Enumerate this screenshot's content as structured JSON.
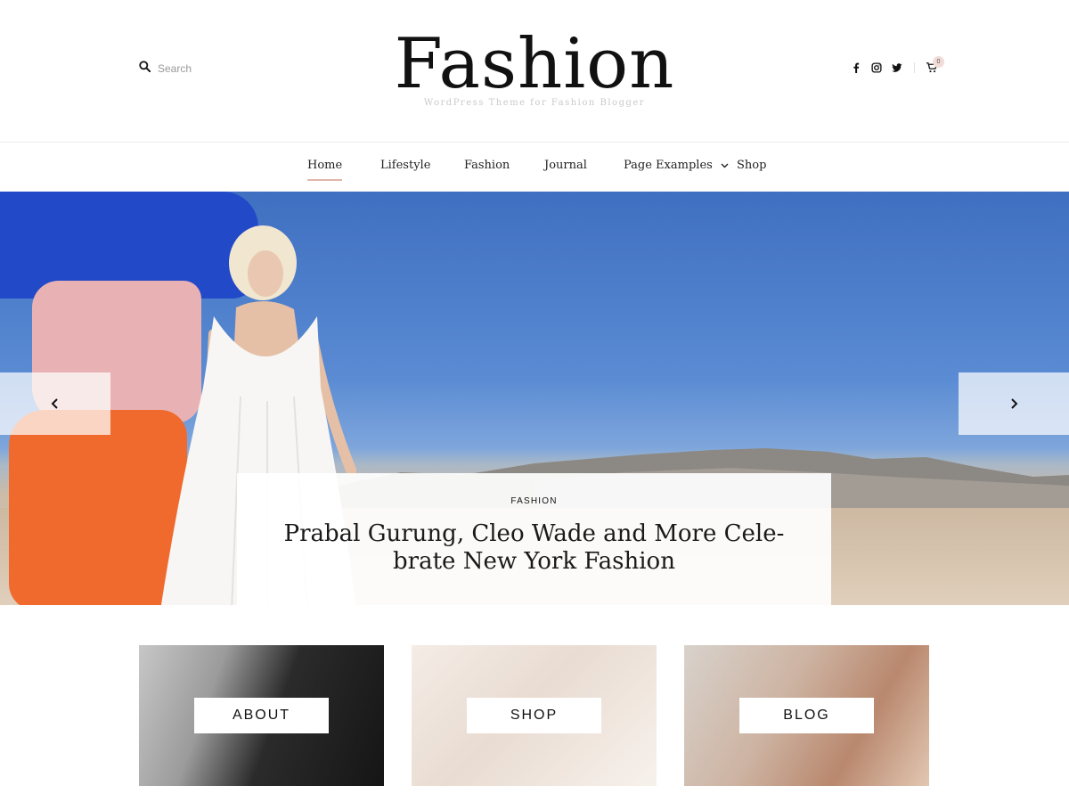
{
  "header": {
    "search_placeholder": "Search",
    "logo": "Fashion",
    "tagline": "WordPress Theme for Fashion Blogger",
    "social": [
      "facebook-icon",
      "instagram-icon",
      "twitter-icon"
    ],
    "cart_count": "0"
  },
  "nav": {
    "items": [
      {
        "label": "Home",
        "active": true
      },
      {
        "label": "Lifestyle"
      },
      {
        "label": "Fashion"
      },
      {
        "label": "Journal"
      },
      {
        "label": "Page Examples",
        "has_dropdown": true
      },
      {
        "label": "Shop"
      }
    ]
  },
  "hero": {
    "category": "FASHION",
    "title": "Prabal Gurung, Cleo Wade and More Cele-brate New York Fashion"
  },
  "promos": [
    {
      "label": "ABOUT"
    },
    {
      "label": "SHOP"
    },
    {
      "label": "BLOG"
    }
  ],
  "colors": {
    "accent": "#e0b6a8",
    "text": "#111111",
    "cart_badge": "#f2dcd8"
  }
}
